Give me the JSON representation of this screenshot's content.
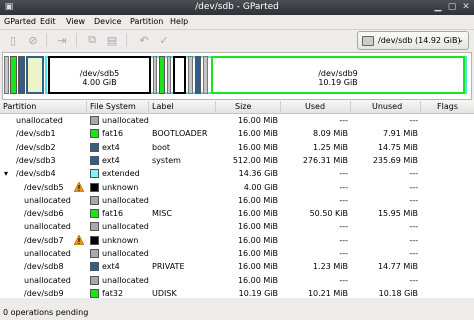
{
  "window": {
    "title": "/dev/sdb - GParted"
  },
  "menu": [
    "GParted",
    "Edit",
    "View",
    "Device",
    "Partition",
    "Help"
  ],
  "toolbar_icons": [
    "new-icon",
    "delete-icon",
    "resize-icon",
    "copy-icon",
    "paste-icon",
    "undo-icon",
    "apply-icon"
  ],
  "device": {
    "label": "/dev/sdb  (14.92 GiB)"
  },
  "diskmap": {
    "seg1": {
      "name": "/dev/sdb5",
      "size": "4.00 GiB"
    },
    "seg2": {
      "name": "/dev/sdb9",
      "size": "10.19 GiB"
    }
  },
  "columns": [
    "Partition",
    "File System",
    "Label",
    "Size",
    "Used",
    "Unused",
    "Flags"
  ],
  "colors": {
    "fat16": "#1be41b",
    "ext4": "#2f5f8a",
    "unallocated": "#a9a9a9",
    "extended": "#7ef3f3",
    "unknown": "#000000",
    "fat32": "#1be41b"
  },
  "rows": [
    {
      "partition": "unallocated",
      "fs": "unallocated",
      "fs_color": "#a9a9a9",
      "label": "",
      "size": "16.00 MiB",
      "used": "---",
      "unused": "---",
      "flags": "",
      "indent": 1,
      "warn": false
    },
    {
      "partition": "/dev/sdb1",
      "fs": "fat16",
      "fs_color": "#1be41b",
      "label": "BOOTLOADER",
      "size": "16.00 MiB",
      "used": "8.09 MiB",
      "unused": "7.91 MiB",
      "flags": "",
      "indent": 1,
      "warn": false
    },
    {
      "partition": "/dev/sdb2",
      "fs": "ext4",
      "fs_color": "#2f5f8a",
      "label": "boot",
      "size": "16.00 MiB",
      "used": "1.25 MiB",
      "unused": "14.75 MiB",
      "flags": "",
      "indent": 1,
      "warn": false
    },
    {
      "partition": "/dev/sdb3",
      "fs": "ext4",
      "fs_color": "#2f5f8a",
      "label": "system",
      "size": "512.00 MiB",
      "used": "276.31 MiB",
      "unused": "235.69 MiB",
      "flags": "",
      "indent": 1,
      "warn": false
    },
    {
      "partition": "/dev/sdb4",
      "fs": "extended",
      "fs_color": "#7ef3f3",
      "label": "",
      "size": "14.36 GiB",
      "used": "---",
      "unused": "---",
      "flags": "",
      "indent": 1,
      "warn": false,
      "expander": true
    },
    {
      "partition": "/dev/sdb5",
      "fs": "unknown",
      "fs_color": "#000000",
      "label": "",
      "size": "4.00 GiB",
      "used": "---",
      "unused": "---",
      "flags": "",
      "indent": 2,
      "warn": true
    },
    {
      "partition": "unallocated",
      "fs": "unallocated",
      "fs_color": "#a9a9a9",
      "label": "",
      "size": "16.00 MiB",
      "used": "---",
      "unused": "---",
      "flags": "",
      "indent": 2,
      "warn": false
    },
    {
      "partition": "/dev/sdb6",
      "fs": "fat16",
      "fs_color": "#1be41b",
      "label": "MISC",
      "size": "16.00 MiB",
      "used": "50.50 KiB",
      "unused": "15.95 MiB",
      "flags": "",
      "indent": 2,
      "warn": false
    },
    {
      "partition": "unallocated",
      "fs": "unallocated",
      "fs_color": "#a9a9a9",
      "label": "",
      "size": "16.00 MiB",
      "used": "---",
      "unused": "---",
      "flags": "",
      "indent": 2,
      "warn": false
    },
    {
      "partition": "/dev/sdb7",
      "fs": "unknown",
      "fs_color": "#000000",
      "label": "",
      "size": "16.00 MiB",
      "used": "---",
      "unused": "---",
      "flags": "",
      "indent": 2,
      "warn": true
    },
    {
      "partition": "unallocated",
      "fs": "unallocated",
      "fs_color": "#a9a9a9",
      "label": "",
      "size": "16.00 MiB",
      "used": "---",
      "unused": "---",
      "flags": "",
      "indent": 2,
      "warn": false
    },
    {
      "partition": "/dev/sdb8",
      "fs": "ext4",
      "fs_color": "#2f5f8a",
      "label": "PRIVATE",
      "size": "16.00 MiB",
      "used": "1.23 MiB",
      "unused": "14.77 MiB",
      "flags": "",
      "indent": 2,
      "warn": false
    },
    {
      "partition": "unallocated",
      "fs": "unallocated",
      "fs_color": "#a9a9a9",
      "label": "",
      "size": "16.00 MiB",
      "used": "---",
      "unused": "---",
      "flags": "",
      "indent": 2,
      "warn": false
    },
    {
      "partition": "/dev/sdb9",
      "fs": "fat32",
      "fs_color": "#1be41b",
      "label": "UDISK",
      "size": "10.19 GiB",
      "used": "10.21 MiB",
      "unused": "10.18 GiB",
      "flags": "",
      "indent": 2,
      "warn": false
    }
  ],
  "status": {
    "text": "0 operations pending"
  }
}
